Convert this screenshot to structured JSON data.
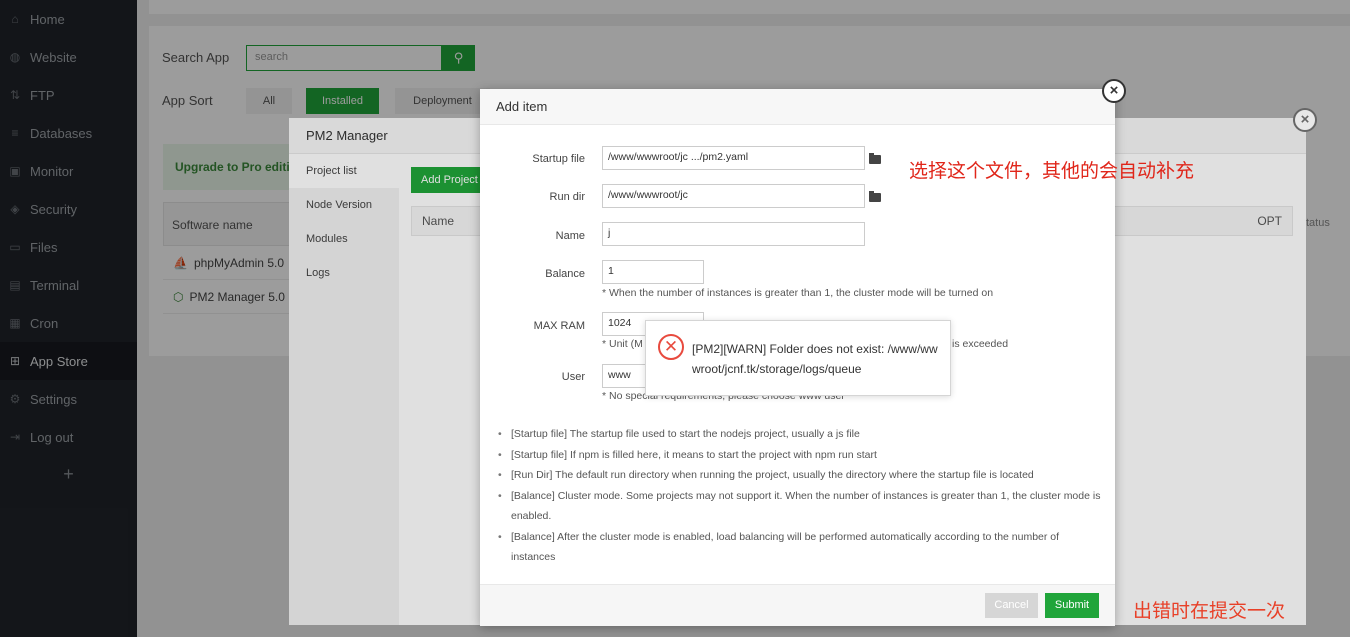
{
  "sidebar": {
    "items": [
      {
        "label": "Home",
        "icon": "home-icon"
      },
      {
        "label": "Website",
        "icon": "globe-icon"
      },
      {
        "label": "FTP",
        "icon": "ftp-icon"
      },
      {
        "label": "Databases",
        "icon": "database-icon"
      },
      {
        "label": "Monitor",
        "icon": "monitor-icon"
      },
      {
        "label": "Security",
        "icon": "shield-icon"
      },
      {
        "label": "Files",
        "icon": "folder-icon"
      },
      {
        "label": "Terminal",
        "icon": "terminal-icon"
      },
      {
        "label": "Cron",
        "icon": "calendar-icon"
      },
      {
        "label": "App Store",
        "icon": "apps-icon"
      },
      {
        "label": "Settings",
        "icon": "gear-icon"
      },
      {
        "label": "Log out",
        "icon": "logout-icon"
      }
    ],
    "add_label": "+"
  },
  "appstore": {
    "search_label": "Search App",
    "search_placeholder": "search",
    "sort_label": "App Sort",
    "sort_all": "All",
    "sort_installed": "Installed",
    "sort_deployment": "Deployment",
    "upgrade_text": "Upgrade to Pro editi",
    "software_name_header": "Software name",
    "status_header": "tatus",
    "rows": [
      {
        "name": "phpMyAdmin 5.0"
      },
      {
        "name": "PM2 Manager 5.0"
      }
    ]
  },
  "pm2": {
    "title": "PM2 Manager",
    "nav": [
      "Project list",
      "Node Version",
      "Modules",
      "Logs"
    ],
    "add_project": "Add Project",
    "col_name": "Name",
    "col_opt": "OPT"
  },
  "add_item": {
    "title": "Add item",
    "startup_file_label": "Startup file",
    "startup_file_value": "/www/wwwroot/jc   .../pm2.yaml",
    "run_dir_label": "Run dir",
    "run_dir_value": "/www/wwwroot/jc",
    "name_label": "Name",
    "name_value": "j",
    "balance_label": "Balance",
    "balance_value": "1",
    "balance_hint": "* When the number of instances is greater than 1, the cluster mode will be turned on",
    "maxram_label": "MAX RAM",
    "maxram_value": "1024",
    "maxram_hint_start": "* Unit (M",
    "maxram_hint_end": "is exceeded",
    "user_label": "User",
    "user_value": "www",
    "user_hint": "* No special requirements, please choose www user",
    "tips": [
      "[Startup file] The startup file used to start the nodejs project, usually a js file",
      "[Startup file] If npm is filled here, it means to start the project with npm run start",
      "[Run Dir] The default run directory when running the project, usually the directory where the startup file is located",
      "[Balance] Cluster mode. Some projects may not support it. When the number of instances is greater than 1, the cluster mode is enabled.",
      "[Balance] After the cluster mode is enabled, load balancing will be performed automatically according to the number of instances"
    ],
    "cancel_label": "Cancel",
    "submit_label": "Submit"
  },
  "toast": {
    "message": "[PM2][WARN] Folder does not exist: /www/wwwroot/jcnf.tk/storage/logs/queue"
  },
  "annotations": {
    "choose_file": "选择这个文件，其他的会自动补充",
    "resubmit": "出错时在提交一次"
  },
  "colors": {
    "accent": "#20a53a",
    "sidebar_bg": "#20242a",
    "error": "#e84a3e",
    "annotation": "#e0261a"
  }
}
